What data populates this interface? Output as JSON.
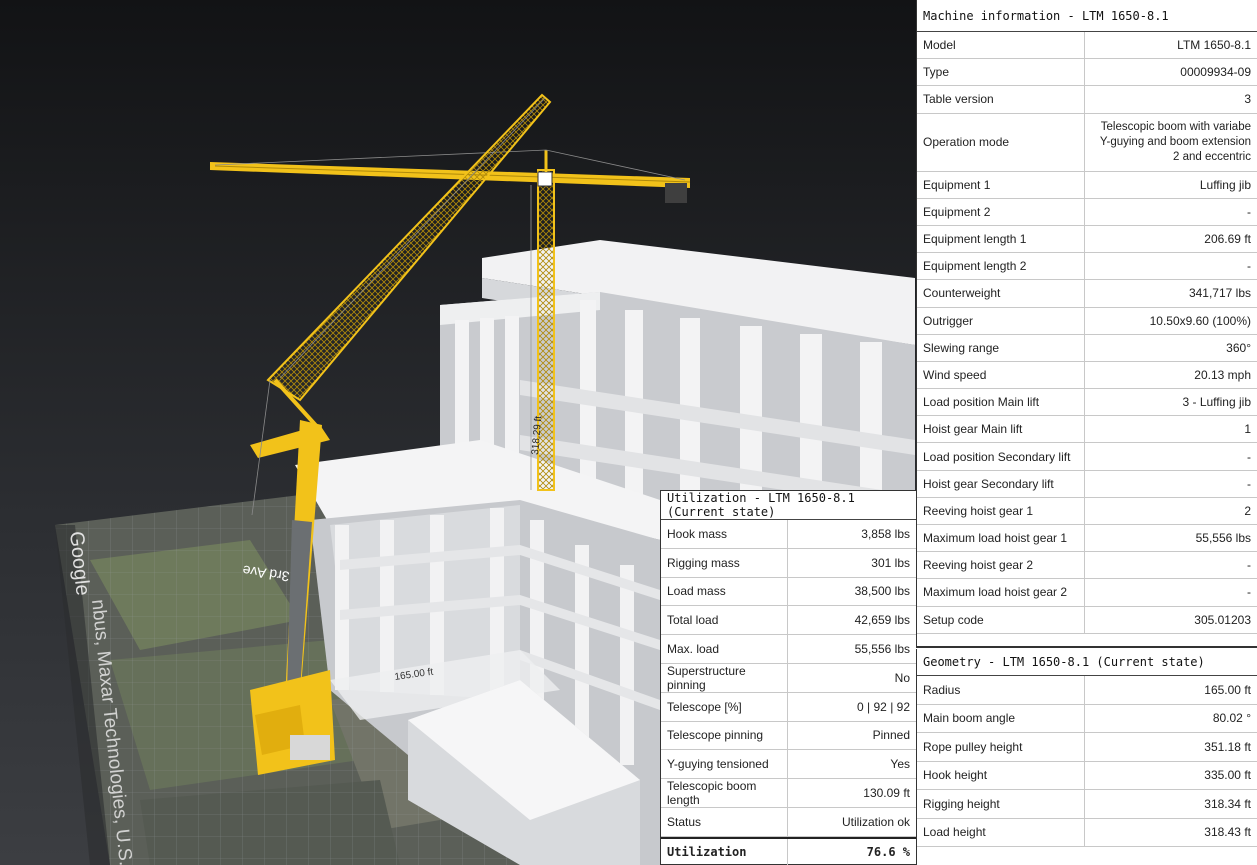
{
  "scene": {
    "google_watermark": "Google",
    "imagery_credit": "nbus, Maxar Technologies, U.S. Ge",
    "street_label": "3rd Ave",
    "radius_label": "165.00 ft",
    "height_label": "318.29 ft",
    "colors": {
      "crane": "#f2c21a",
      "building": "#e7e8ea",
      "sky_top": "#121315",
      "sky_bottom": "#3a3c40"
    }
  },
  "machine": {
    "title": "Machine information - LTM 1650-8.1",
    "rows": [
      {
        "label": "Model",
        "value": "LTM 1650-8.1"
      },
      {
        "label": "Type",
        "value": "00009934-09"
      },
      {
        "label": "Table version",
        "value": "3"
      },
      {
        "label": "Operation mode",
        "value": "Telescopic boom with variabe Y-guying and boom extension 2 and eccentric"
      },
      {
        "label": "Equipment 1",
        "value": "Luffing jib"
      },
      {
        "label": "Equipment 2",
        "value": "-"
      },
      {
        "label": "Equipment length 1",
        "value": "206.69 ft"
      },
      {
        "label": "Equipment length 2",
        "value": "-"
      },
      {
        "label": "Counterweight",
        "value": "341,717 lbs"
      },
      {
        "label": "Outrigger",
        "value": "10.50x9.60 (100%)"
      },
      {
        "label": "Slewing range",
        "value": "360°"
      },
      {
        "label": "Wind speed",
        "value": "20.13 mph"
      },
      {
        "label": "Load position Main lift",
        "value": "3 - Luffing jib"
      },
      {
        "label": "Hoist gear Main lift",
        "value": "1"
      },
      {
        "label": "Load position Secondary lift",
        "value": "-"
      },
      {
        "label": "Hoist gear Secondary lift",
        "value": "-"
      },
      {
        "label": "Reeving hoist gear 1",
        "value": "2"
      },
      {
        "label": "Maximum load hoist gear 1",
        "value": "55,556 lbs"
      },
      {
        "label": "Reeving hoist gear 2",
        "value": "-"
      },
      {
        "label": "Maximum load hoist gear 2",
        "value": "-"
      },
      {
        "label": "Setup code",
        "value": "305.01203"
      }
    ]
  },
  "utilization": {
    "title": "Utilization - LTM 1650-8.1 (Current state)",
    "rows": [
      {
        "label": "Hook mass",
        "value": "3,858 lbs"
      },
      {
        "label": "Rigging mass",
        "value": "301 lbs"
      },
      {
        "label": "Load mass",
        "value": "38,500 lbs"
      },
      {
        "label": "Total load",
        "value": "42,659 lbs"
      },
      {
        "label": "Max. load",
        "value": "55,556 lbs"
      },
      {
        "label": "Superstructure pinning",
        "value": "No"
      },
      {
        "label": "Telescope [%]",
        "value": "0 | 92 | 92"
      },
      {
        "label": "Telescope pinning",
        "value": "Pinned"
      },
      {
        "label": "Y-guying tensioned",
        "value": "Yes"
      },
      {
        "label": "Telescopic boom length",
        "value": "130.09 ft"
      },
      {
        "label": "Status",
        "value": "Utilization ok"
      }
    ],
    "total_label": "Utilization",
    "total_value": "76.6 %"
  },
  "geometry": {
    "title": "Geometry - LTM 1650-8.1 (Current state)",
    "rows": [
      {
        "label": "Radius",
        "value": "165.00 ft"
      },
      {
        "label": "Main boom angle",
        "value": "80.02 °"
      },
      {
        "label": "Rope pulley height",
        "value": "351.18 ft"
      },
      {
        "label": "Hook height",
        "value": "335.00 ft"
      },
      {
        "label": "Rigging height",
        "value": "318.34 ft"
      },
      {
        "label": "Load height",
        "value": "318.43 ft"
      }
    ]
  }
}
